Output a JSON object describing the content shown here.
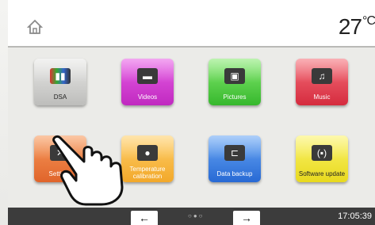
{
  "header": {
    "temperature": "27",
    "temperature_unit": "°C",
    "home_icon": "home-icon"
  },
  "tiles": [
    {
      "label": "DSA",
      "icon": "tooth-chart-icon",
      "color": "#c8c8c6"
    },
    {
      "label": "Videos",
      "icon": "video-icon",
      "color": "#d83ad6"
    },
    {
      "label": "Pictures",
      "icon": "pictures-icon",
      "color": "#4fcb3e"
    },
    {
      "label": "Music",
      "icon": "music-note-icon",
      "color": "#e23a4c"
    },
    {
      "label": "Settings",
      "icon": "tools-icon",
      "color": "#ec7a3f"
    },
    {
      "label": "Temperature calibration",
      "icon": "calibration-icon",
      "color": "#f8b53c"
    },
    {
      "label": "Data backup",
      "icon": "usb-icon",
      "color": "#3a7fe0"
    },
    {
      "label": "Software update",
      "icon": "update-icon",
      "color": "#f2e63a"
    }
  ],
  "footer": {
    "prev_arrow": "←",
    "next_arrow": "→",
    "page_dots": "○●○",
    "time": "17:05:39"
  }
}
